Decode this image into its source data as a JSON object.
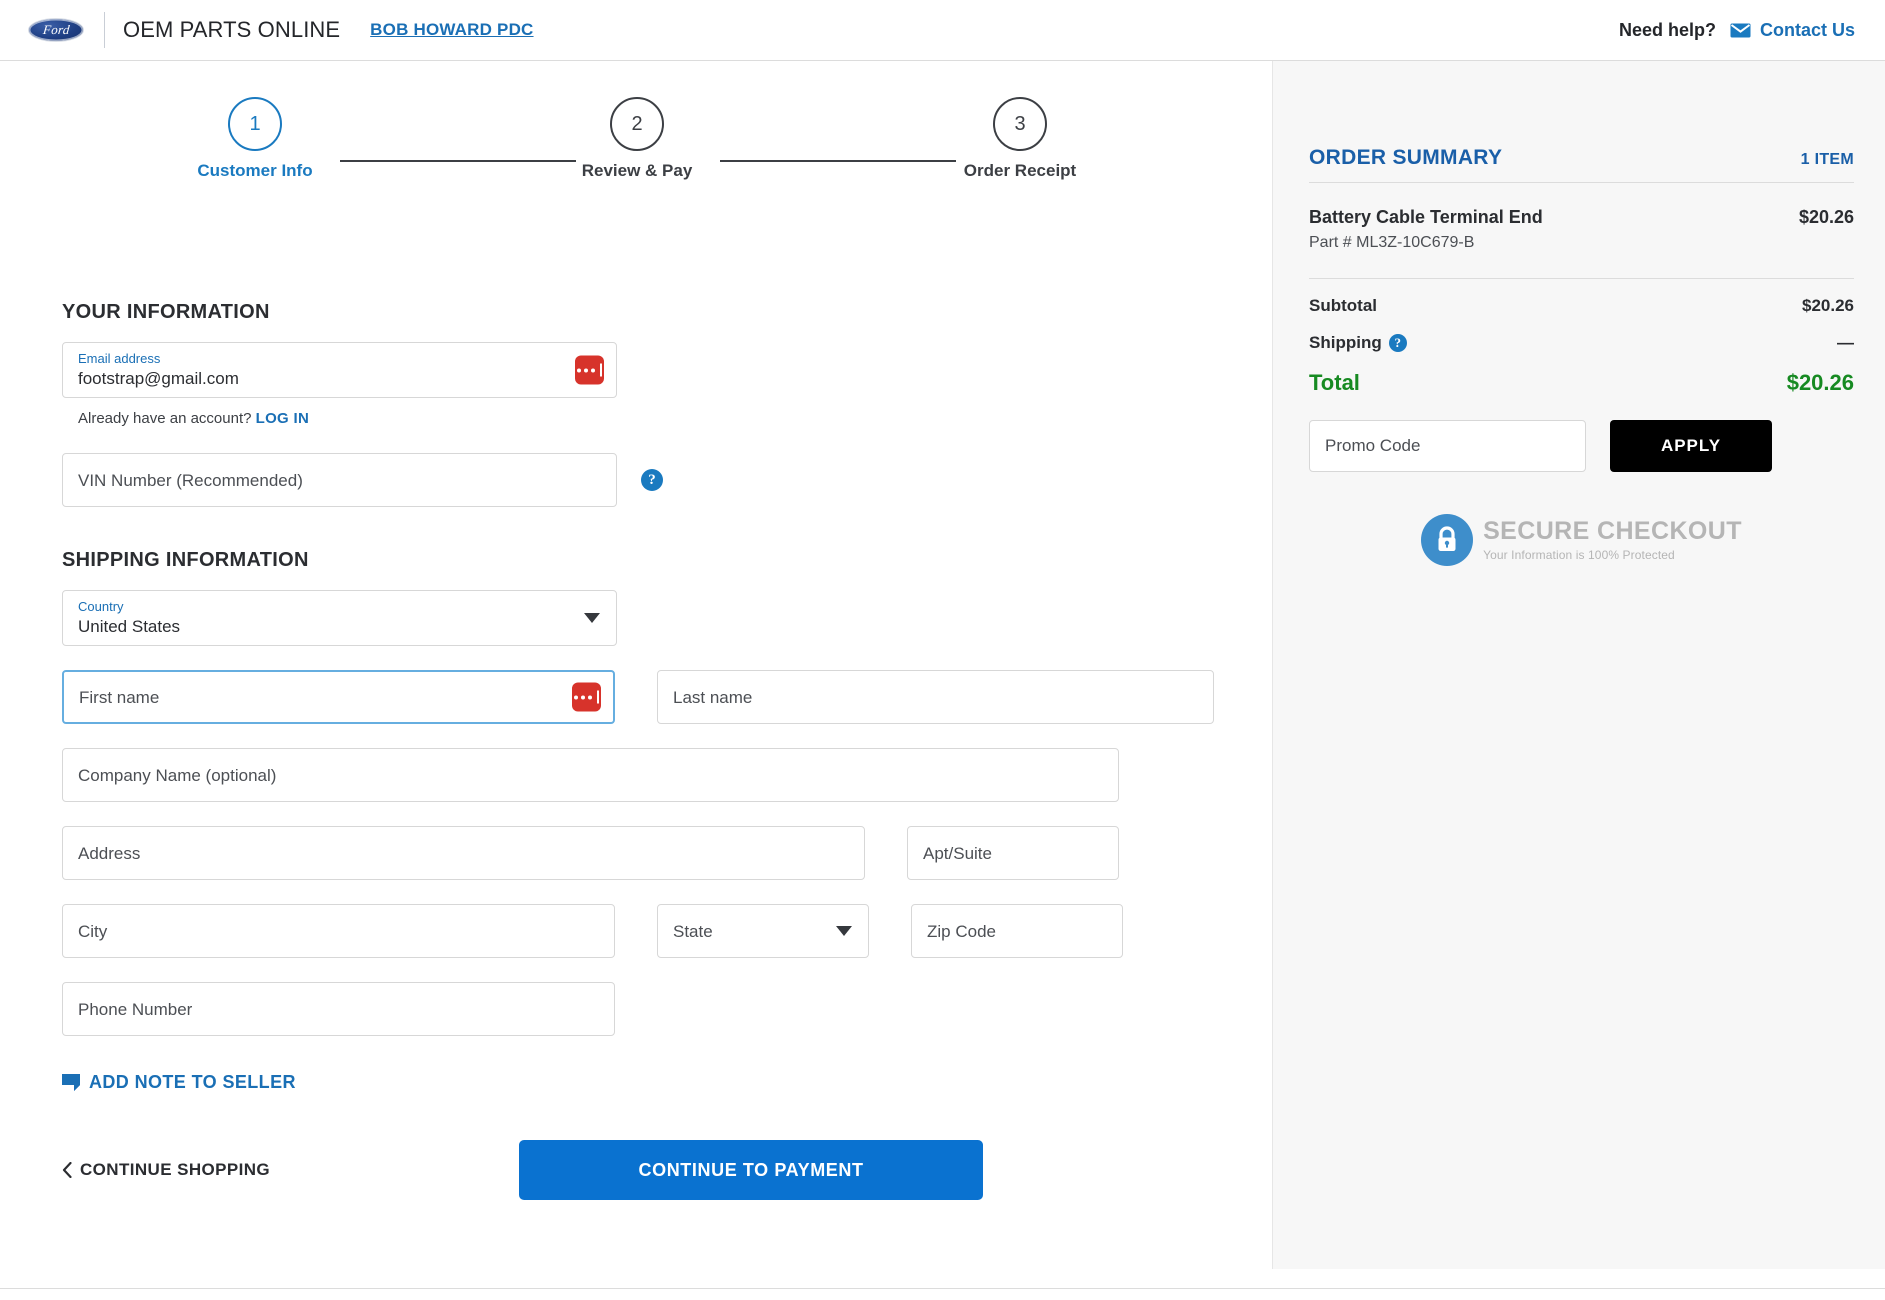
{
  "header": {
    "logo_alt": "Ford",
    "brand_title": "OEM PARTS ONLINE",
    "dealer_name": "BOB HOWARD PDC",
    "need_help": "Need help?",
    "contact_us": "Contact Us"
  },
  "stepper": {
    "steps": [
      {
        "number": "1",
        "label": "Customer Info",
        "active": true
      },
      {
        "number": "2",
        "label": "Review & Pay",
        "active": false
      },
      {
        "number": "3",
        "label": "Order Receipt",
        "active": false
      }
    ]
  },
  "your_information": {
    "section_title": "YOUR INFORMATION",
    "email_label": "Email address",
    "email_value": "footstrap@gmail.com",
    "account_prompt": "Already have an account?",
    "login_label": "LOG IN",
    "vin_placeholder": "VIN Number (Recommended)",
    "vin_value": "",
    "help_glyph": "?"
  },
  "shipping_information": {
    "section_title": "SHIPPING INFORMATION",
    "country_label": "Country",
    "country_value": "United States",
    "first_name_placeholder": "First name",
    "first_name_value": "",
    "last_name_placeholder": "Last name",
    "last_name_value": "",
    "company_placeholder": "Company Name (optional)",
    "company_value": "",
    "address_placeholder": "Address",
    "address_value": "",
    "apt_placeholder": "Apt/Suite",
    "apt_value": "",
    "city_placeholder": "City",
    "city_value": "",
    "state_placeholder": "State",
    "state_value": "",
    "zip_placeholder": "Zip Code",
    "zip_value": "",
    "phone_placeholder": "Phone Number",
    "phone_value": "",
    "add_note_label": "ADD NOTE TO SELLER"
  },
  "actions": {
    "continue_shopping": "CONTINUE SHOPPING",
    "continue_to_payment": "CONTINUE TO PAYMENT"
  },
  "order_summary": {
    "title": "ORDER SUMMARY",
    "item_count": "1 ITEM",
    "items": [
      {
        "name": "Battery Cable Terminal End",
        "part_number": "Part # ML3Z-10C679-B",
        "price": "$20.26"
      }
    ],
    "subtotal_label": "Subtotal",
    "subtotal_value": "$20.26",
    "shipping_label": "Shipping",
    "shipping_value": "—",
    "total_label": "Total",
    "total_value": "$20.26",
    "promo_placeholder": "Promo Code",
    "promo_value": "",
    "apply_label": "APPLY"
  },
  "secure_badge": {
    "title": "SECURE CHECKOUT",
    "subtitle": "Your Information is 100% Protected"
  },
  "colors": {
    "brand_blue": "#1a6fb5",
    "accent_blue": "#0a72d0",
    "summary_blue": "#1a5fa8",
    "total_green": "#178a22",
    "lastpass_red": "#d7332b",
    "panel_bg": "#f7f7f7"
  }
}
